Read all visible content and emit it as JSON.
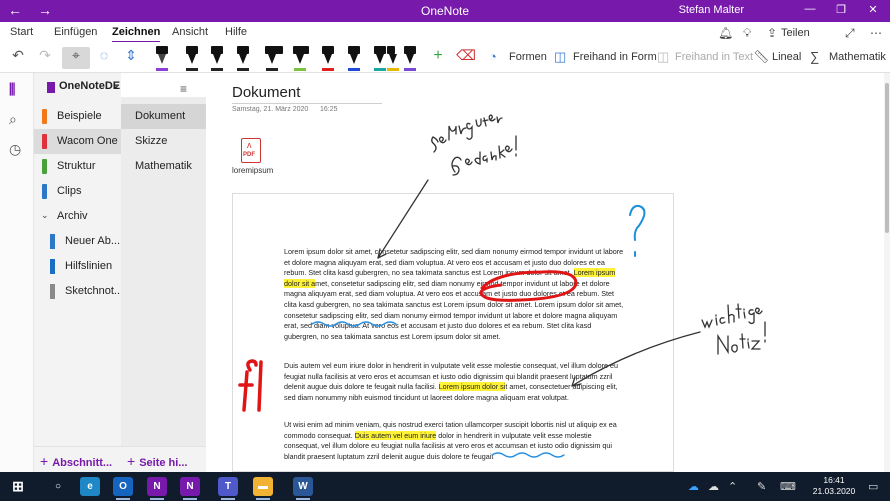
{
  "window": {
    "title": "OneNote",
    "user": "Stefan Malter",
    "back_icon": "back-arrow-icon",
    "forward_icon": "forward-arrow-icon",
    "min_icon": "minimize-icon",
    "max_icon": "restore-icon",
    "close_icon": "close-icon"
  },
  "ribbon": {
    "tabs": [
      "Start",
      "Einfügen",
      "Zeichnen",
      "Ansicht",
      "Hilfe"
    ],
    "active_tab": "Zeichnen",
    "share_label": "Teilen"
  },
  "toolbar": {
    "shapes_label": "Formen",
    "ink_to_shape_label": "Freihand in Form",
    "ink_to_text_label": "Freihand in Text",
    "ruler_label": "Lineal",
    "math_label": "Mathematik",
    "pen_colors": [
      "#8b3fd6",
      "#222222",
      "#222222",
      "#222222",
      "#222222",
      "#7cc242",
      "#e02020",
      "#1f4bd6",
      "#19a7a0",
      "#e6b800",
      "#7a4ad6"
    ]
  },
  "notebook": {
    "name": "OneNoteDE",
    "sections": [
      {
        "label": "Beispiele",
        "color": "#f07a1a"
      },
      {
        "label": "Wacom One",
        "color": "#e0323c"
      },
      {
        "label": "Struktur",
        "color": "#4aa13c"
      },
      {
        "label": "Clips",
        "color": "#2b77c8"
      }
    ],
    "active_section": "Wacom One",
    "group": {
      "label": "Archiv",
      "subsections": [
        {
          "label": "Neuer Ab...",
          "color": "#2b77c8"
        },
        {
          "label": "Hilfslinien",
          "color": "#1a6fc4"
        },
        {
          "label": "Sketchnot...",
          "color": "#8a8a8a"
        }
      ]
    },
    "add_section_label": "Abschnitt...",
    "add_page_label": "Seite hi..."
  },
  "pages": {
    "items": [
      "Dokument",
      "Skizze",
      "Mathematik"
    ],
    "active": "Dokument"
  },
  "page": {
    "title": "Dokument",
    "date": "Samstag, 21. März 2020",
    "time": "16:25",
    "attachment_name": "loremipsum",
    "attachment_type": "PDF",
    "para1": [
      {
        "t": "Lorem ipsum dolor sit amet, consetetur sadipscing elitr, sed diam nonumy eirmod tempor invidunt ut labore et dolore magna aliquyam erat, sed diam voluptua. At vero eos et accusam et justo duo dolores et ea rebum. Stet clita kasd gubergren, no sea takimata sanctus est Lorem ipsum dolor sit amet. ",
        "hl": false
      },
      {
        "t": "Lorem ipsum dolor sit a",
        "hl": true
      },
      {
        "t": "met, consetetur sadipscing elitr, sed diam nonumy eirmod tempor invidunt ut labore et dolore magna aliquyam erat, sed diam voluptua. At vero eos et accusam et justo duo dolores et ea rebum. Stet clita kasd gubergren, no sea takimata sanctus est Lorem ipsum dolor sit amet. Lorem ipsum dolor sit amet, consetetur sadipscing elitr, sed diam nonumy eirmod tempor invidunt ut labore et dolore magna aliquyam erat, sed diam voluptua. At vero eos et accusam et justo duo dolores et ea rebum. Stet clita kasd gubergren, no sea takimata sanctus est Lorem ipsum dolor sit amet.",
        "hl": false
      }
    ],
    "para2": [
      {
        "t": "Duis autem vel eum iriure dolor in hendrerit in vulputate velit esse molestie consequat, vel illum dolore eu feugiat nulla facilisis at vero eros et accumsan et iusto odio dignissim qui blandit praesent luptatum zzril delenit augue duis dolore te feugait nulla facilisi. ",
        "hl": false
      },
      {
        "t": "Lorem ipsum dolor si",
        "hl": true
      },
      {
        "t": "t amet, consectetuer adipiscing elit, sed diam nonummy nibh euismod tincidunt ut laoreet dolore magna aliquam erat volutpat.",
        "hl": false
      }
    ],
    "para3": [
      {
        "t": "Ut wisi enim ad minim veniam, quis nostrud exerci tation ullamcorper suscipit lobortis nisl ut aliquip ex ea commodo consequat. ",
        "hl": false
      },
      {
        "t": "Duis autem vel eum iriure",
        "hl": true
      },
      {
        "t": " dolor in hendrerit in vulputate velit esse molestie consequat, vel illum dolore eu feugiat nulla facilisis at vero eros et accumsan et iusto odio dignissim qui blandit praesent luptatum zzril delenit augue duis dolore te feugait",
        "hl": false
      }
    ]
  },
  "taskbar": {
    "time": "16:41",
    "date": "21.03.2020",
    "apps": [
      {
        "icon": "search-icon",
        "glyph": "○",
        "color": "transparent"
      },
      {
        "icon": "edge-icon",
        "glyph": "e",
        "color": "#1e88c7"
      },
      {
        "icon": "outlook-icon",
        "glyph": "O",
        "color": "#1565c0"
      },
      {
        "icon": "onenote-icon",
        "glyph": "N",
        "color": "#7719aa"
      },
      {
        "icon": "onenote-2016-icon",
        "glyph": "N",
        "color": "#7719aa"
      },
      {
        "icon": "teams-icon",
        "glyph": "T",
        "color": "#5059c9"
      },
      {
        "icon": "file-explorer-icon",
        "glyph": "▬",
        "color": "#f2b233"
      },
      {
        "icon": "word-icon",
        "glyph": "W",
        "color": "#2b5797"
      },
      {
        "icon": "wacom-icon",
        "glyph": "w",
        "color": "#f4f4f4"
      },
      {
        "icon": "tablet-icon",
        "glyph": "▮",
        "color": "#2a9be0"
      }
    ]
  }
}
